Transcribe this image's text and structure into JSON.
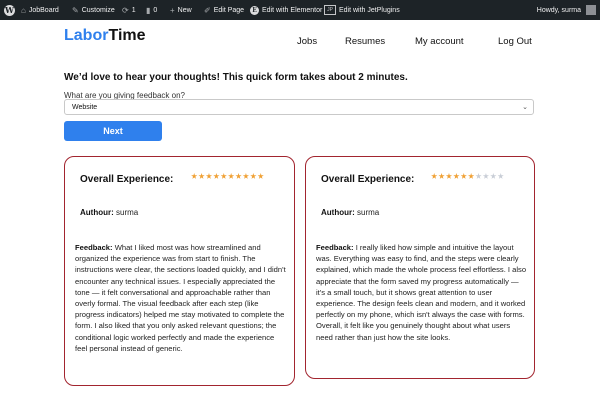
{
  "admin_bar": {
    "site": "JobBoard",
    "customize": "Customize",
    "updates_count": "1",
    "comments_count": "0",
    "new": "New",
    "edit_page": "Edit Page",
    "edit_elementor": "Edit with Elementor",
    "edit_jetplugins": "Edit with JetPlugins",
    "howdy": "Howdy, surma"
  },
  "header": {
    "logo_part1": "Labor",
    "logo_part2": "Time",
    "nav": [
      "Jobs",
      "Resumes",
      "My account",
      "Log Out"
    ]
  },
  "form": {
    "intro": "We’d love to hear your thoughts! This quick form takes about 2 minutes.",
    "question": "What are you giving feedback on?",
    "selected": "Website",
    "next_label": "Next"
  },
  "cards": [
    {
      "title": "Overall Experience:",
      "rating": 1.0,
      "star_count": 10,
      "author_label": "Authour:",
      "author": "surma",
      "feedback_label": "Feedback:",
      "feedback": "What I liked most was how streamlined and organized the experience was from start to finish. The instructions were clear, the sections loaded quickly, and I didn't encounter any technical issues. I especially appreciated the tone — it felt conversational and approachable rather than overly formal. The visual feedback after each step (like progress indicators) helped me stay motivated to complete the form. I also liked that you only asked relevant questions; the conditional logic worked perfectly and made the experience feel personal instead of generic."
    },
    {
      "title": "Overall Experience:",
      "rating": 0.6,
      "star_count": 10,
      "author_label": "Authour:",
      "author": "surma",
      "feedback_label": "Feedback:",
      "feedback": "I really liked how simple and intuitive the layout was. Everything was easy to find, and the steps were clearly explained, which made the whole process feel effortless. I also appreciate that the form saved my progress automatically — it's a small touch, but it shows great attention to user experience. The design feels clean and modern, and it worked perfectly on my phone, which isn't always the case with forms. Overall, it felt like you genuinely thought about what users need rather than just how the site looks."
    }
  ],
  "colors": {
    "admin_bar_bg": "#1d2327",
    "accent": "#2f80ed",
    "card_border": "#a2252f",
    "star_on": "#f0a033",
    "star_off": "#c8cdd6"
  }
}
